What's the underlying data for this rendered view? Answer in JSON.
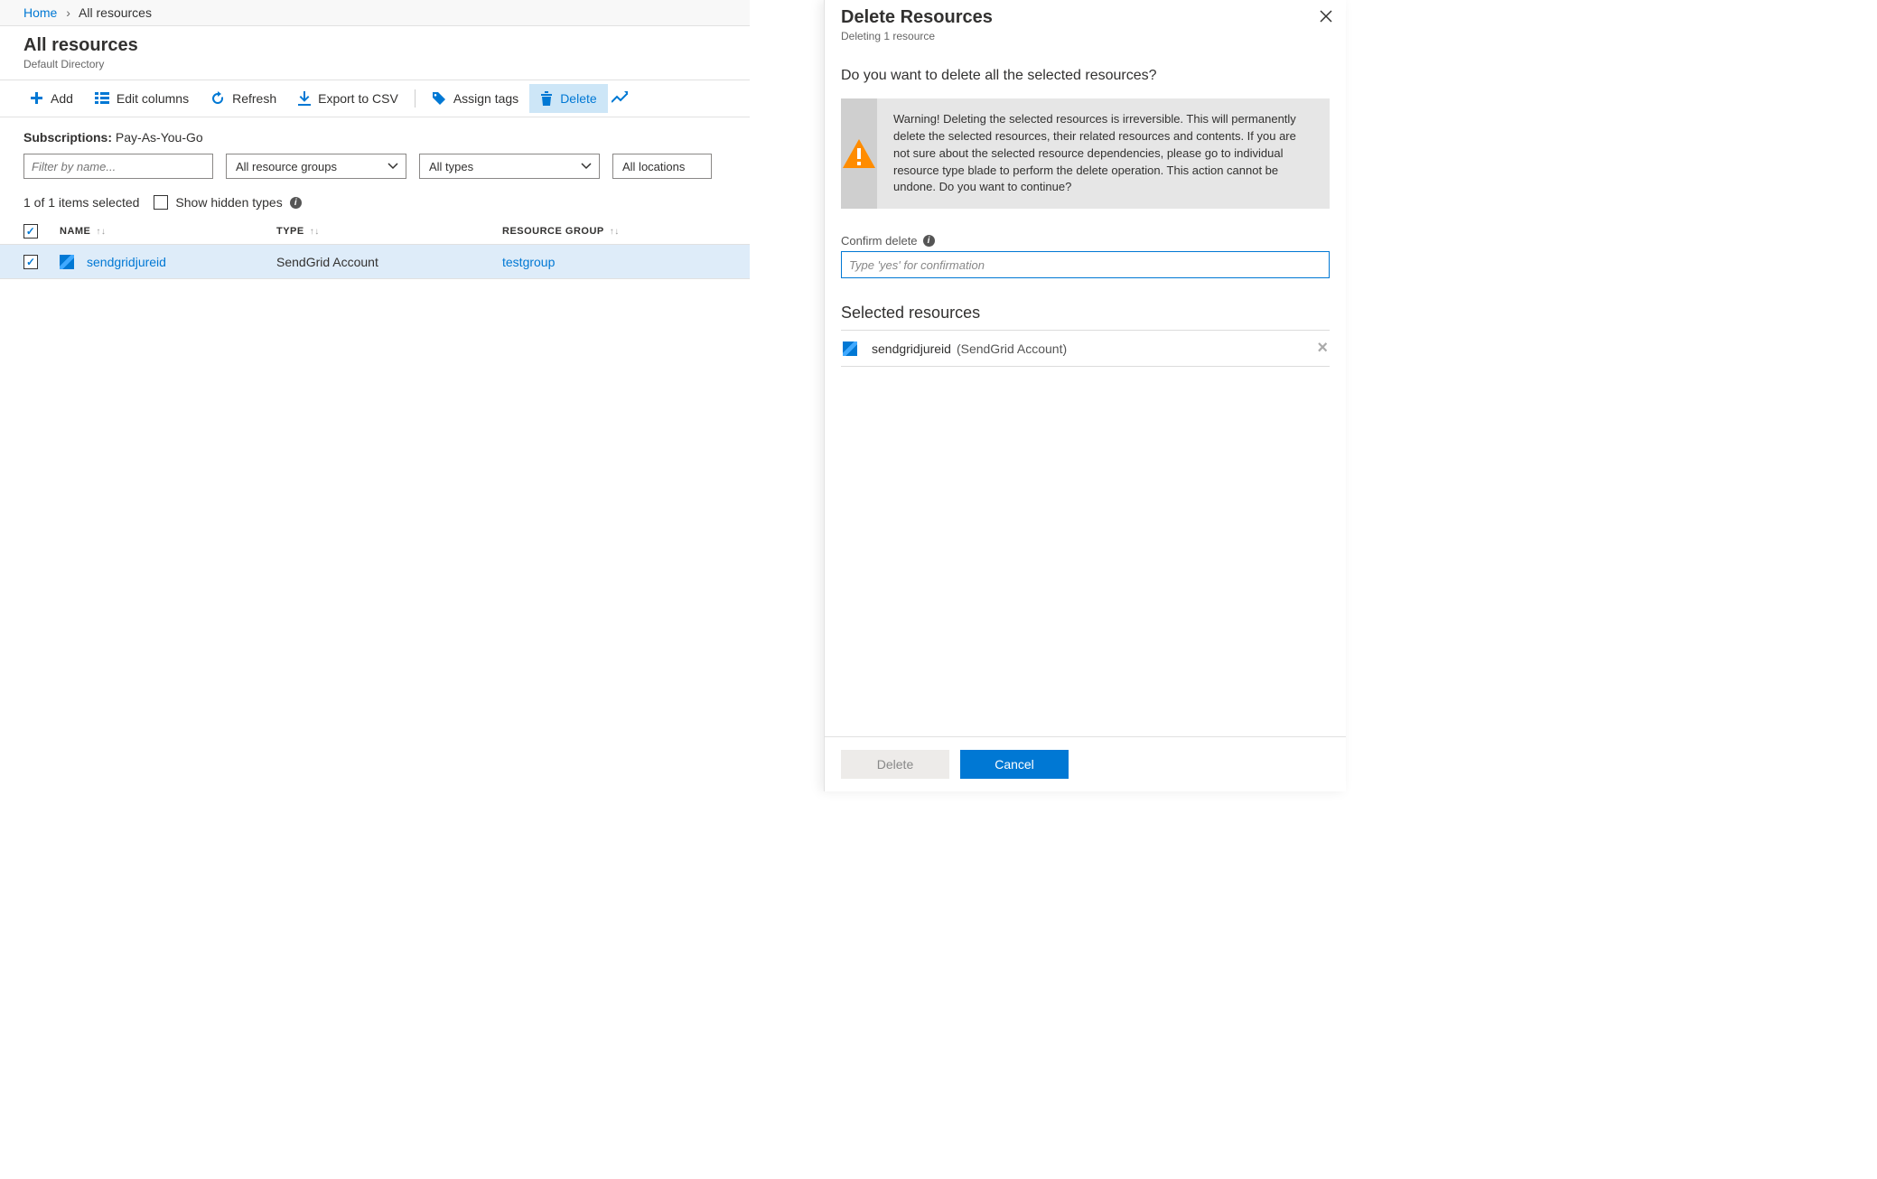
{
  "breadcrumb": {
    "home": "Home",
    "current": "All resources"
  },
  "page": {
    "title": "All resources",
    "subtitle": "Default Directory"
  },
  "toolbar": {
    "add": "Add",
    "edit_columns": "Edit columns",
    "refresh": "Refresh",
    "export_csv": "Export to CSV",
    "assign_tags": "Assign tags",
    "delete": "Delete"
  },
  "subscriptions": {
    "label": "Subscriptions:",
    "value": "Pay-As-You-Go"
  },
  "filters": {
    "name_placeholder": "Filter by name...",
    "resource_groups": "All resource groups",
    "types": "All types",
    "locations": "All locations"
  },
  "list": {
    "status": "1 of 1 items selected",
    "show_hidden": "Show hidden types",
    "headers": {
      "name": "NAME",
      "type": "TYPE",
      "resource_group": "RESOURCE GROUP"
    },
    "rows": [
      {
        "name": "sendgridjureid",
        "type": "SendGrid Account",
        "resource_group": "testgroup",
        "checked": true
      }
    ]
  },
  "panel": {
    "title": "Delete Resources",
    "subtitle": "Deleting 1 resource",
    "prompt": "Do you want to delete all the selected resources?",
    "warning": "Warning! Deleting the selected resources is irreversible. This will permanently delete the selected resources, their related resources and contents. If you are not sure about the selected resource dependencies, please go to individual resource type blade to perform the delete operation. This action cannot be undone. Do you want to continue?",
    "confirm_label": "Confirm delete",
    "confirm_placeholder": "Type 'yes' for confirmation",
    "selected_title": "Selected resources",
    "selected": [
      {
        "name": "sendgridjureid",
        "type_label": "(SendGrid Account)"
      }
    ],
    "buttons": {
      "delete": "Delete",
      "cancel": "Cancel"
    }
  }
}
